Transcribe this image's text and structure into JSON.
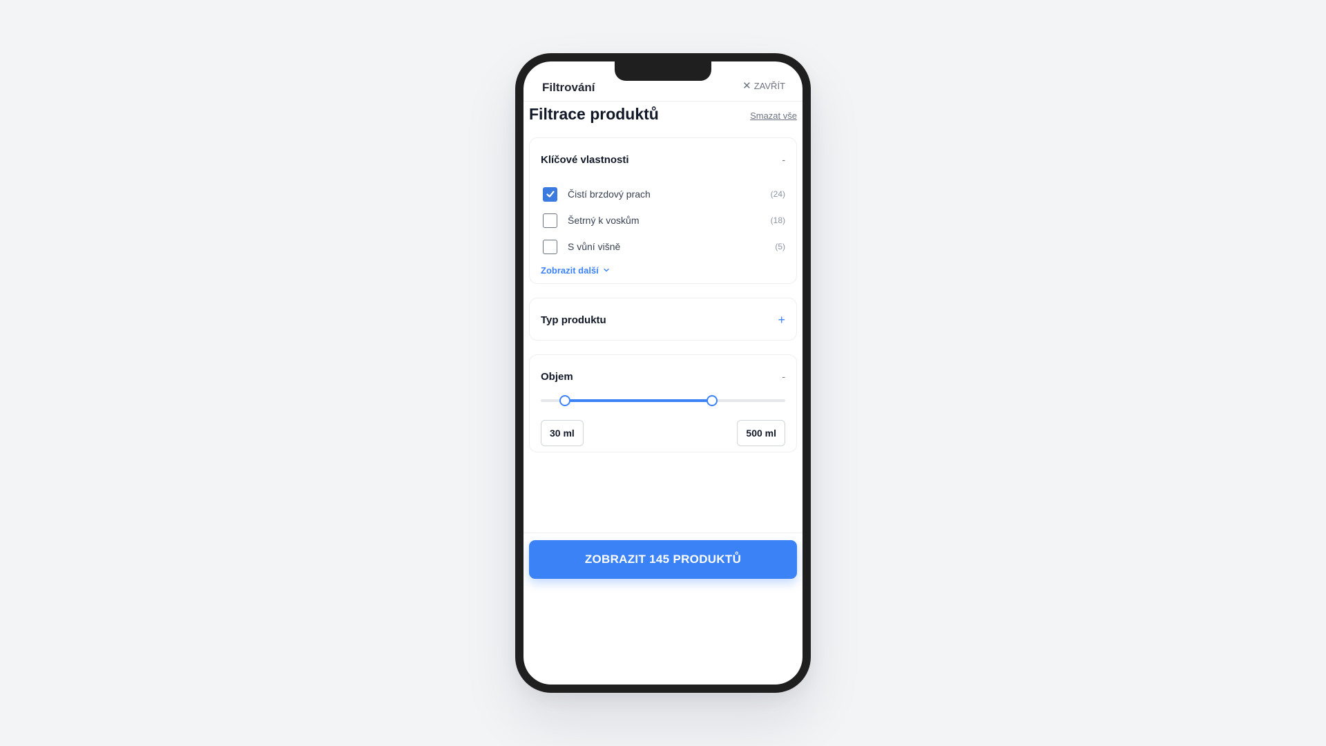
{
  "header": {
    "title": "Filtrování",
    "close_label": "ZAVŘÍT"
  },
  "page": {
    "title": "Filtrace produktů",
    "clear_all": "Smazat vše"
  },
  "sections": {
    "key_properties": {
      "title": "Klíčové vlastnosti",
      "toggle": "-",
      "options": [
        {
          "label": "Čistí brzdový prach",
          "count": "(24)",
          "checked": true
        },
        {
          "label": "Šetrný k voskům",
          "count": "(18)",
          "checked": false
        },
        {
          "label": "S vůní višně",
          "count": "(5)",
          "checked": false
        }
      ],
      "show_more": "Zobrazit další"
    },
    "product_type": {
      "title": "Typ produktu",
      "toggle": "+"
    },
    "volume": {
      "title": "Objem",
      "toggle": "-",
      "min_value": "30 ml",
      "max_value": "500 ml",
      "range_min_fraction": 0.1,
      "range_max_fraction": 0.7
    }
  },
  "cta": {
    "label": "ZOBRAZIT 145 PRODUKTŮ"
  },
  "icons": {
    "close": "close-icon",
    "check": "checkmark-icon",
    "chevron": "chevron-down-icon"
  },
  "colors": {
    "accent": "#3b82f6",
    "text": "#111827",
    "muted": "#6b7280"
  }
}
